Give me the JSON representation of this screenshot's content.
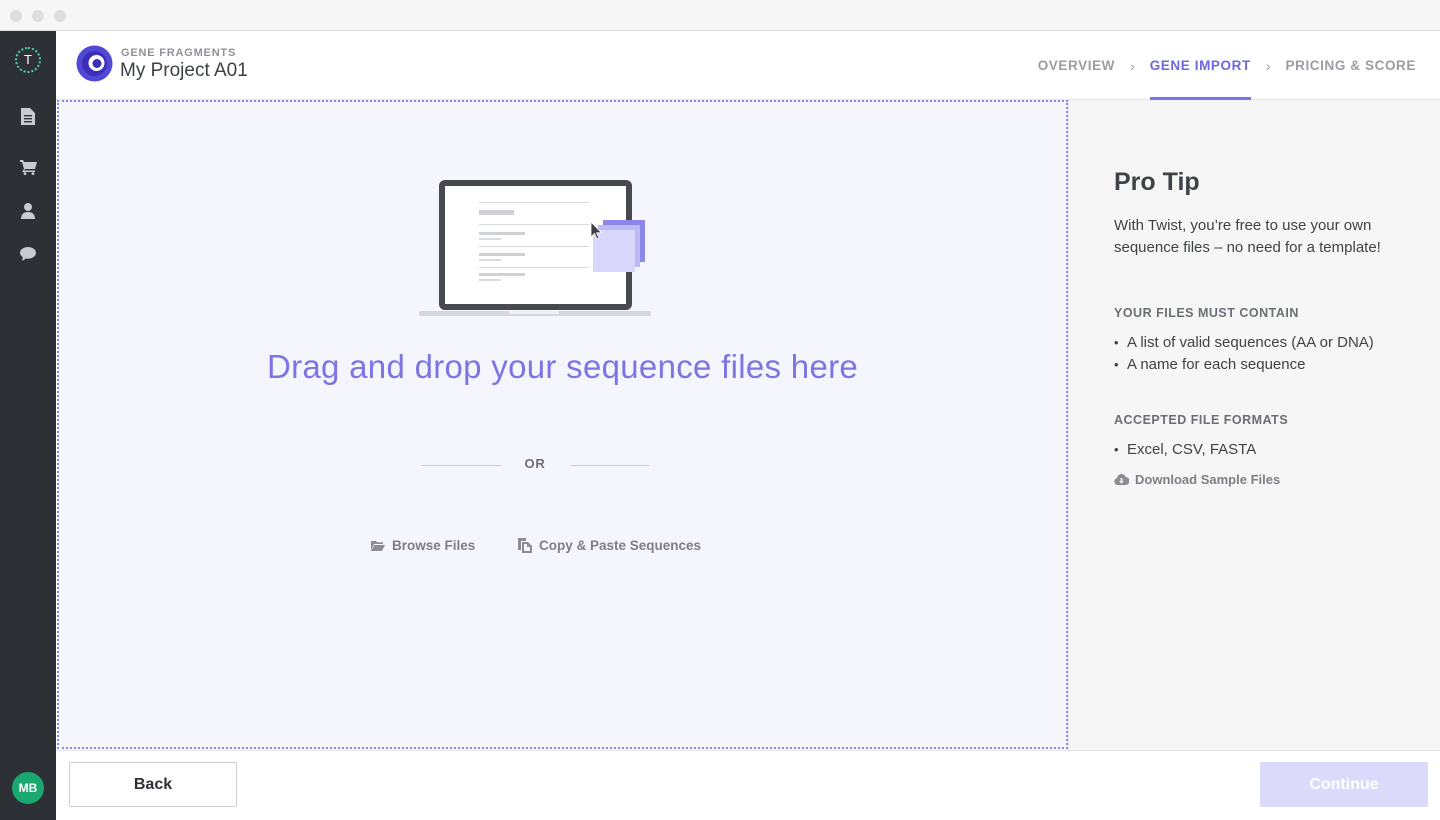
{
  "window": {
    "controls": [
      "close",
      "minimize",
      "maximize"
    ]
  },
  "sidebar": {
    "logo_letter": "T",
    "items": [
      {
        "name": "documents",
        "icon": "document-icon"
      },
      {
        "name": "cart",
        "icon": "cart-icon"
      },
      {
        "name": "account",
        "icon": "user-icon"
      },
      {
        "name": "chat",
        "icon": "chat-icon"
      }
    ],
    "avatar_initials": "MB",
    "avatar_color": "#1aa770"
  },
  "header": {
    "project_type": "GENE FRAGMENTS",
    "project_name": "My Project A01",
    "steps": [
      {
        "label": "OVERVIEW",
        "active": false
      },
      {
        "label": "GENE IMPORT",
        "active": true
      },
      {
        "label": "PRICING & SCORE",
        "active": false
      }
    ]
  },
  "dropzone": {
    "title": "Drag and drop your sequence files here",
    "or_label": "OR",
    "browse_label": "Browse Files",
    "paste_label": "Copy & Paste Sequences"
  },
  "tips": {
    "title": "Pro Tip",
    "body": "With Twist, you’re free to use your own sequence files – no need for a template!",
    "must_contain_heading": "YOUR FILES MUST CONTAIN",
    "must_contain": [
      "A list of valid sequences (AA or DNA)",
      "A name for each sequence"
    ],
    "formats_heading": "ACCEPTED FILE FORMATS",
    "formats": [
      "Excel, CSV, FASTA"
    ],
    "download_label": "Download Sample Files"
  },
  "footer": {
    "back_label": "Back",
    "continue_label": "Continue",
    "continue_disabled": true
  },
  "colors": {
    "accent": "#7c74e6",
    "sidebar_bg": "#2d3035",
    "dropzone_bg": "#f5f5fd",
    "continue_disabled_bg": "#dcdafa"
  }
}
